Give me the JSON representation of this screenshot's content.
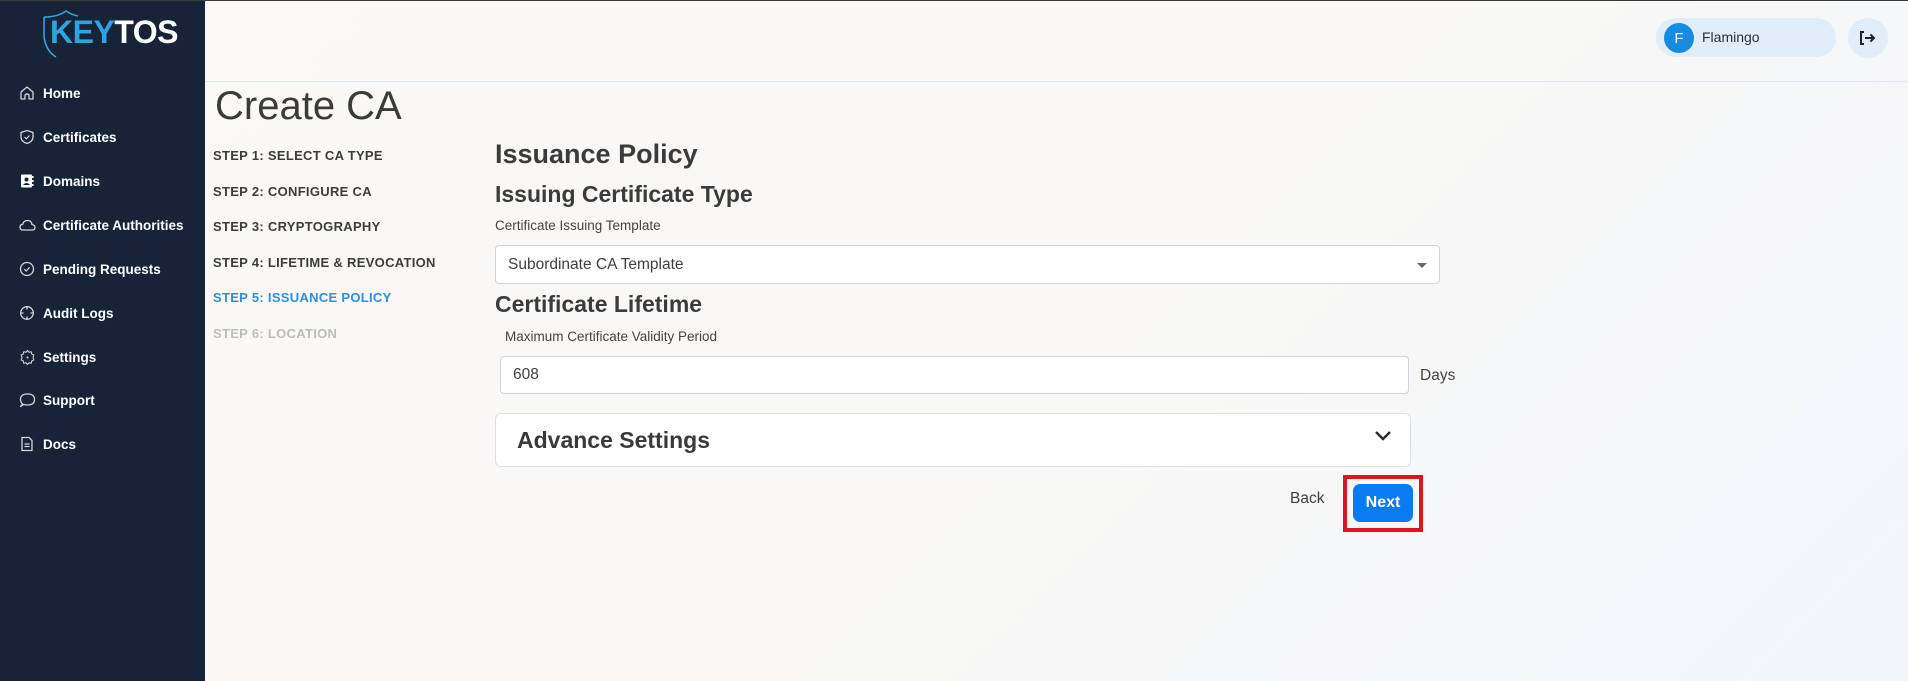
{
  "app": {
    "logo_part1": "KEY",
    "logo_part2": "TOS",
    "brand_color": "#2ea3e0"
  },
  "sidebar": {
    "items": [
      {
        "label": "Home",
        "icon": "home-icon"
      },
      {
        "label": "Certificates",
        "icon": "shield-check-icon"
      },
      {
        "label": "Domains",
        "icon": "contact-book-icon"
      },
      {
        "label": "Certificate Authorities",
        "icon": "cloud-icon"
      },
      {
        "label": "Pending Requests",
        "icon": "check-circle-icon"
      },
      {
        "label": "Audit Logs",
        "icon": "crosshair-icon"
      },
      {
        "label": "Settings",
        "icon": "gear-icon"
      },
      {
        "label": "Support",
        "icon": "chat-bubble-icon"
      },
      {
        "label": "Docs",
        "icon": "document-icon"
      }
    ]
  },
  "header": {
    "user_initial": "F",
    "user_name": "Flamingo",
    "logout_icon": "logout-icon"
  },
  "page": {
    "title": "Create CA",
    "steps": [
      {
        "label": "STEP 1: SELECT CA TYPE",
        "state": "done"
      },
      {
        "label": "STEP 2: CONFIGURE CA",
        "state": "done"
      },
      {
        "label": "STEP 3: CRYPTOGRAPHY",
        "state": "done"
      },
      {
        "label": "STEP 4: LIFETIME & REVOCATION",
        "state": "done"
      },
      {
        "label": "STEP 5: ISSUANCE POLICY",
        "state": "active"
      },
      {
        "label": "STEP 6: LOCATION",
        "state": "disabled"
      }
    ],
    "section_title": "Issuance Policy",
    "issuing_type_title": "Issuing Certificate Type",
    "template_label": "Certificate Issuing Template",
    "template_value": "Subordinate CA Template",
    "lifetime_title": "Certificate Lifetime",
    "validity_label": "Maximum Certificate Validity Period",
    "validity_value": "608",
    "validity_unit": "Days",
    "advance_settings": "Advance Settings",
    "back_label": "Back",
    "next_label": "Next"
  },
  "colors": {
    "sidebar_bg": "#172337",
    "active_step": "#2e8fe0",
    "primary_button": "#0b7bf1",
    "highlight": "#e0141e"
  }
}
